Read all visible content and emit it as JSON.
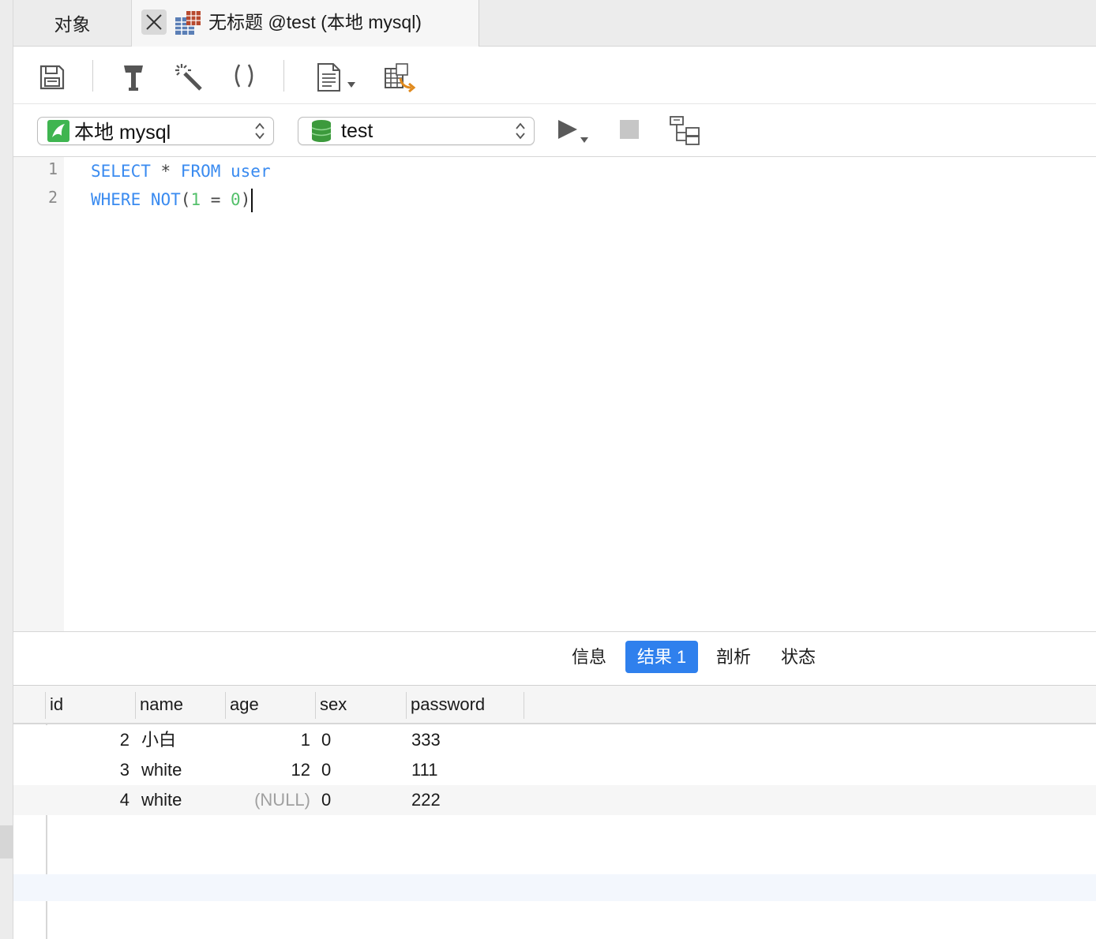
{
  "tabs": {
    "objects_label": "对象",
    "query_title": "无标题 @test (本地 mysql)"
  },
  "toolbar": {
    "icons": [
      "save-icon",
      "hammer-icon",
      "magic-wand-icon",
      "parentheses-icon",
      "document-icon",
      "table-export-icon"
    ]
  },
  "connection": {
    "value": "本地 mysql"
  },
  "database": {
    "value": "test"
  },
  "editor": {
    "line_numbers": [
      "1",
      "2"
    ],
    "line1": {
      "select": "SELECT",
      "star": " * ",
      "from": "FROM",
      "table": " user"
    },
    "line2": {
      "where": "WHERE",
      "not": " NOT",
      "lparen": "(",
      "one": "1",
      "eq": " = ",
      "zero": "0",
      "rparen": ")"
    }
  },
  "result_tabs": [
    {
      "label": "信息",
      "active": false
    },
    {
      "label": "结果 1",
      "active": true
    },
    {
      "label": "剖析",
      "active": false
    },
    {
      "label": "状态",
      "active": false
    }
  ],
  "grid": {
    "columns": [
      "id",
      "name",
      "age",
      "sex",
      "password"
    ],
    "rows": [
      {
        "id": "2",
        "name": "小白",
        "age": "1",
        "sex": "0",
        "password": "333"
      },
      {
        "id": "3",
        "name": "white",
        "age": "12",
        "sex": "0",
        "password": "111"
      },
      {
        "id": "4",
        "name": "white",
        "age": "(NULL)",
        "sex": "0",
        "password": "222"
      }
    ]
  },
  "colors": {
    "keyword": "#3a8bf0",
    "number": "#54c06b",
    "active_tab": "#2f80ed",
    "null_text": "#a0a0a0"
  }
}
